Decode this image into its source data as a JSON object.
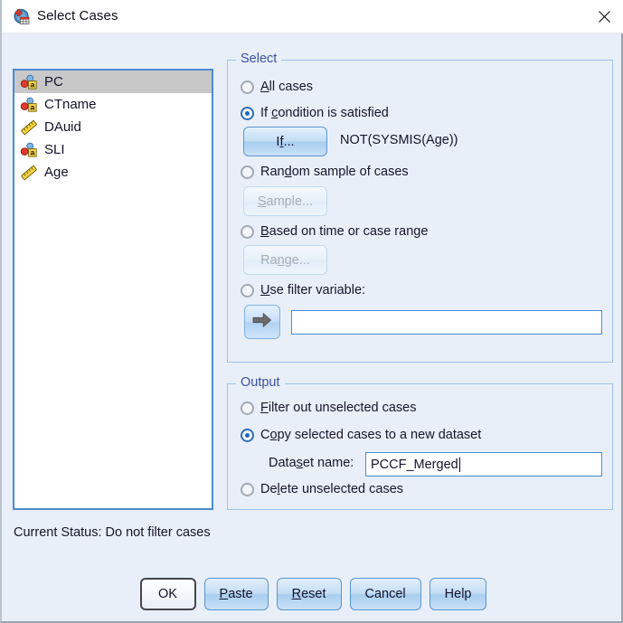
{
  "window": {
    "title": "Select Cases",
    "icon": "spss-select-cases-icon",
    "close_label": "✕"
  },
  "variable_list": {
    "items": [
      {
        "name": "PC",
        "icon": "nominal-string-icon",
        "selected": true
      },
      {
        "name": "CTname",
        "icon": "nominal-string-icon",
        "selected": false
      },
      {
        "name": "DAuid",
        "icon": "scale-ruler-icon",
        "selected": false
      },
      {
        "name": "SLI",
        "icon": "nominal-string-icon",
        "selected": false
      },
      {
        "name": "Age",
        "icon": "scale-ruler-icon",
        "selected": false
      }
    ]
  },
  "select_group": {
    "title": "Select",
    "options": [
      {
        "pre": "",
        "mnemonic": "A",
        "post": "ll cases",
        "selected": false
      },
      {
        "pre": "If ",
        "mnemonic": "c",
        "post": "ondition is satisfied",
        "selected": true
      },
      {
        "pre": "Ran",
        "mnemonic": "d",
        "post": "om sample of cases",
        "selected": false
      },
      {
        "pre": "",
        "mnemonic": "B",
        "post": "ased on time or case range",
        "selected": false
      },
      {
        "pre": "",
        "mnemonic": "U",
        "post": "se filter variable:",
        "selected": false
      }
    ],
    "if_button": {
      "pre": "I",
      "mnemonic": "f",
      "post": "...",
      "enabled": true
    },
    "if_expression": "NOT(SYSMIS(Age))",
    "sample_button": {
      "pre": "",
      "mnemonic": "S",
      "post": "ample...",
      "enabled": false
    },
    "range_button": {
      "pre": "Ra",
      "mnemonic": "n",
      "post": "ge...",
      "enabled": false
    },
    "filter_variable_value": "",
    "arrow_button_icon": "right-arrow-icon"
  },
  "output_group": {
    "title": "Output",
    "options": [
      {
        "pre": "",
        "mnemonic": "F",
        "post": "ilter out unselected cases",
        "selected": false
      },
      {
        "pre": "C",
        "mnemonic": "o",
        "post": "py selected cases to a new dataset",
        "selected": true
      },
      {
        "pre": "De",
        "mnemonic": "l",
        "post": "ete unselected cases",
        "selected": false
      }
    ],
    "dataset_name_label": {
      "pre": "Data",
      "mnemonic": "s",
      "post": "et name:"
    },
    "dataset_name_value": "PCCF_Merged"
  },
  "status": {
    "label": "Current Status: Do not filter cases"
  },
  "footer": {
    "buttons": [
      {
        "pre": "OK",
        "mnemonic": "",
        "post": "",
        "style": "default"
      },
      {
        "pre": "",
        "mnemonic": "P",
        "post": "aste",
        "style": "primary"
      },
      {
        "pre": "",
        "mnemonic": "R",
        "post": "eset",
        "style": "primary"
      },
      {
        "pre": "Cancel",
        "mnemonic": "",
        "post": "",
        "style": "primary"
      },
      {
        "pre": "Help",
        "mnemonic": "",
        "post": "",
        "style": "primary"
      }
    ]
  },
  "colors": {
    "dialog_background": "#e9eff8",
    "titlebar_background": "#ffffff",
    "group_border": "#9dc2e8",
    "group_title_text": "#3a4fa8",
    "field_border": "#4a8cd0",
    "selection_highlight": "#c8c8c8",
    "radio_selected": "#1b68c4",
    "button_blue": "#b0d2f2"
  }
}
